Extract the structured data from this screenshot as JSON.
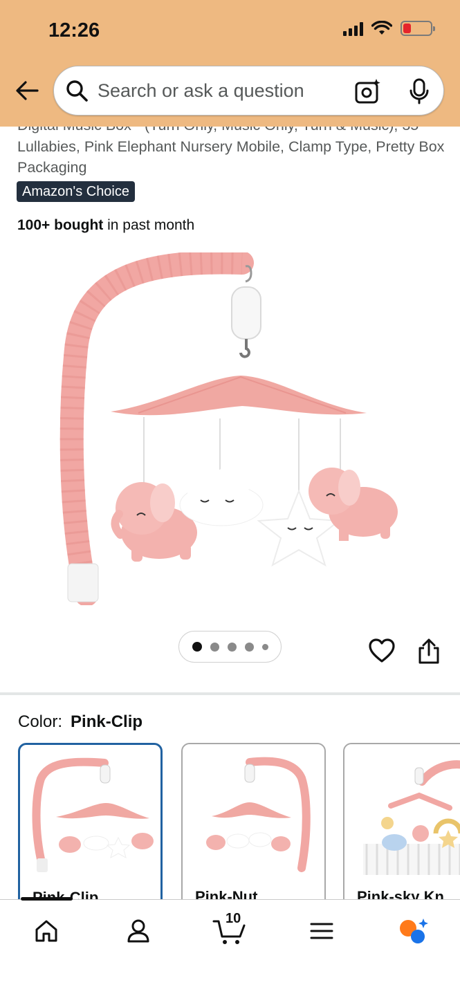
{
  "status_bar": {
    "time": "12:26"
  },
  "search": {
    "placeholder": "Search or ask a question"
  },
  "product": {
    "title": "Digital Music Box - (Turn Only, Music Only, Turn & Music), 35 Lullabies, Pink Elephant Nursery Mobile, Clamp Type, Pretty Box Packaging",
    "badge": "Amazon's Choice",
    "bought_bold": "100+ bought",
    "bought_rest": " in past month"
  },
  "carousel": {
    "image_count": 5,
    "active_index": 0
  },
  "color": {
    "label": "Color:",
    "selected": "Pink-Clip",
    "options": [
      {
        "label": "Pink-Clip",
        "selected": true
      },
      {
        "label": "Pink-Nut",
        "selected": false
      },
      {
        "label": "Pink-sky Kn",
        "selected": false
      }
    ]
  },
  "bottom_nav": {
    "items": [
      "home-icon",
      "account-icon",
      "cart-icon",
      "menu-icon",
      "rufus-icon"
    ],
    "cart_count": "10"
  },
  "colors": {
    "header_bg": "#eeb981",
    "badge_bg": "#232f3e",
    "selected_border": "#2162a1",
    "pink": "#f2a9a6"
  }
}
